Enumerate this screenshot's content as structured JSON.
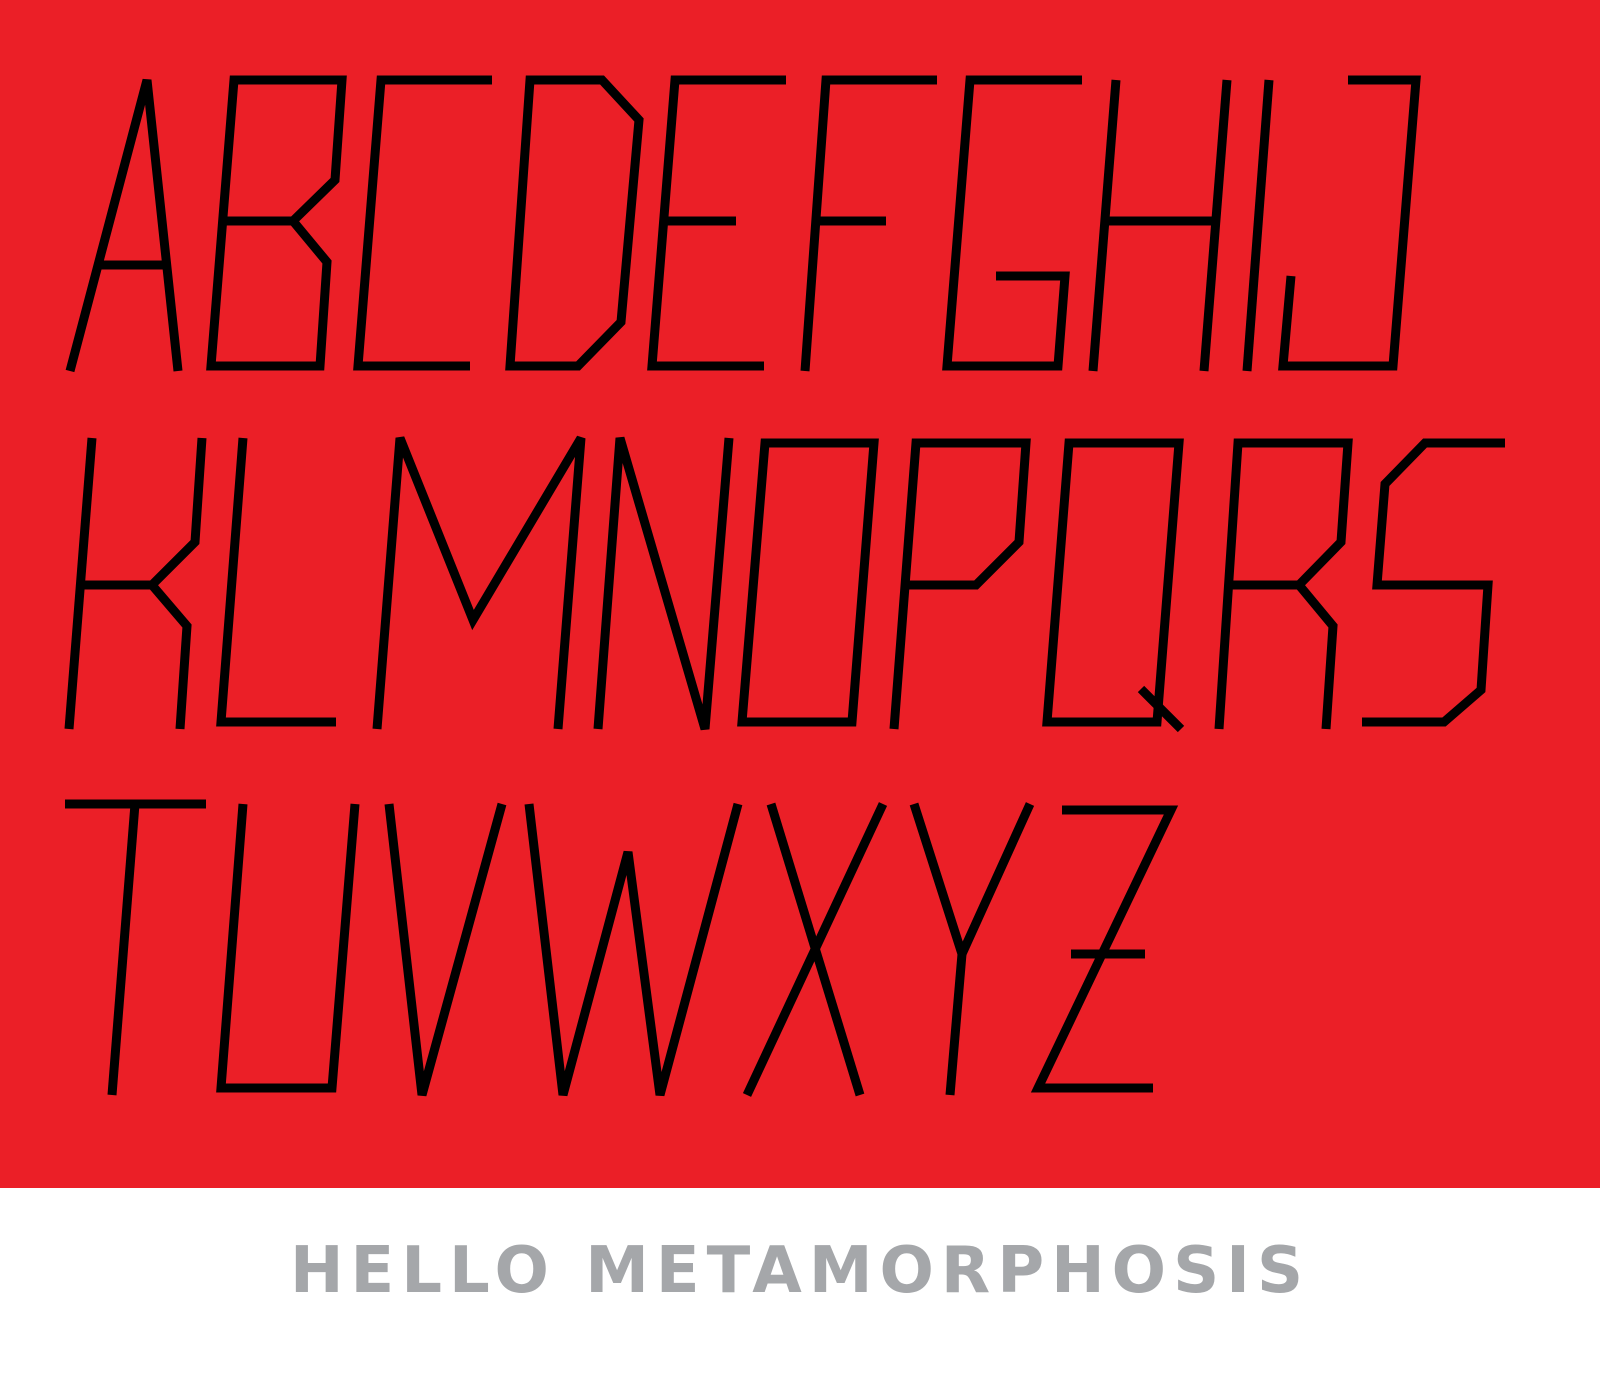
{
  "colors": {
    "panel": "#EB1F27",
    "stroke": "#000000",
    "caption": "#A5A7AA",
    "background": "#FFFFFF"
  },
  "specimen_rows": [
    "ABCDEFGHIJ",
    "KLMNOPQRS",
    "TUVWXYZ"
  ],
  "caption": "HELLO METAMORPHOSIS"
}
